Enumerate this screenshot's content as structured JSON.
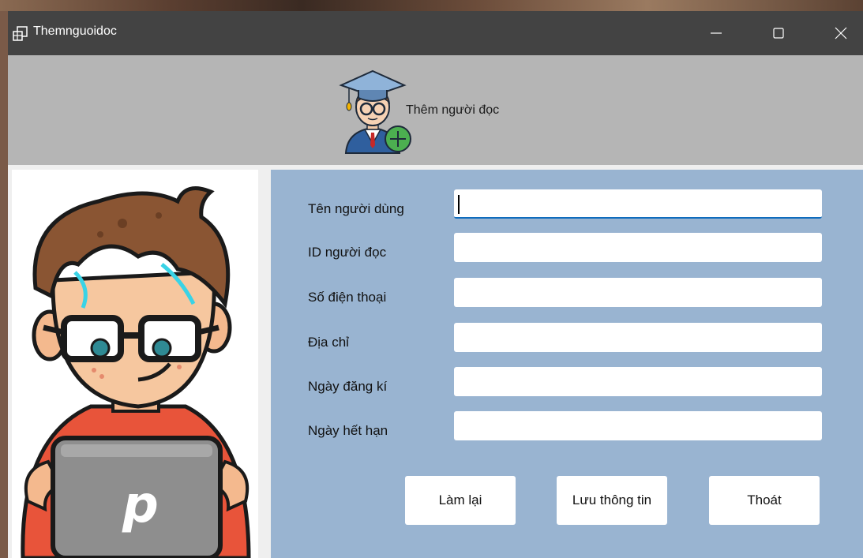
{
  "window": {
    "title": "Themnguoidoc"
  },
  "header": {
    "title": "Thêm người đọc",
    "avatar_icon": "graduate-add-user-icon"
  },
  "illustration": {
    "icon": "reader-with-laptop-illustration",
    "laptop_letter": "p"
  },
  "form": {
    "fields": [
      {
        "label": "Tên người dùng",
        "value": "",
        "focused": true
      },
      {
        "label": "ID người đọc",
        "value": ""
      },
      {
        "label": "Số điện thoại",
        "value": ""
      },
      {
        "label": "Địa chỉ",
        "value": ""
      },
      {
        "label": "Ngày đăng kí",
        "value": ""
      },
      {
        "label": "Ngày hết hạn",
        "value": ""
      }
    ],
    "buttons": {
      "reset": "Làm lại",
      "save": "Lưu thông tin",
      "exit": "Thoát"
    }
  },
  "colors": {
    "titlebar": "#434343",
    "header_band": "#b5b5b5",
    "form_panel": "#99b4d1",
    "focus_accent": "#0f6cbd"
  }
}
